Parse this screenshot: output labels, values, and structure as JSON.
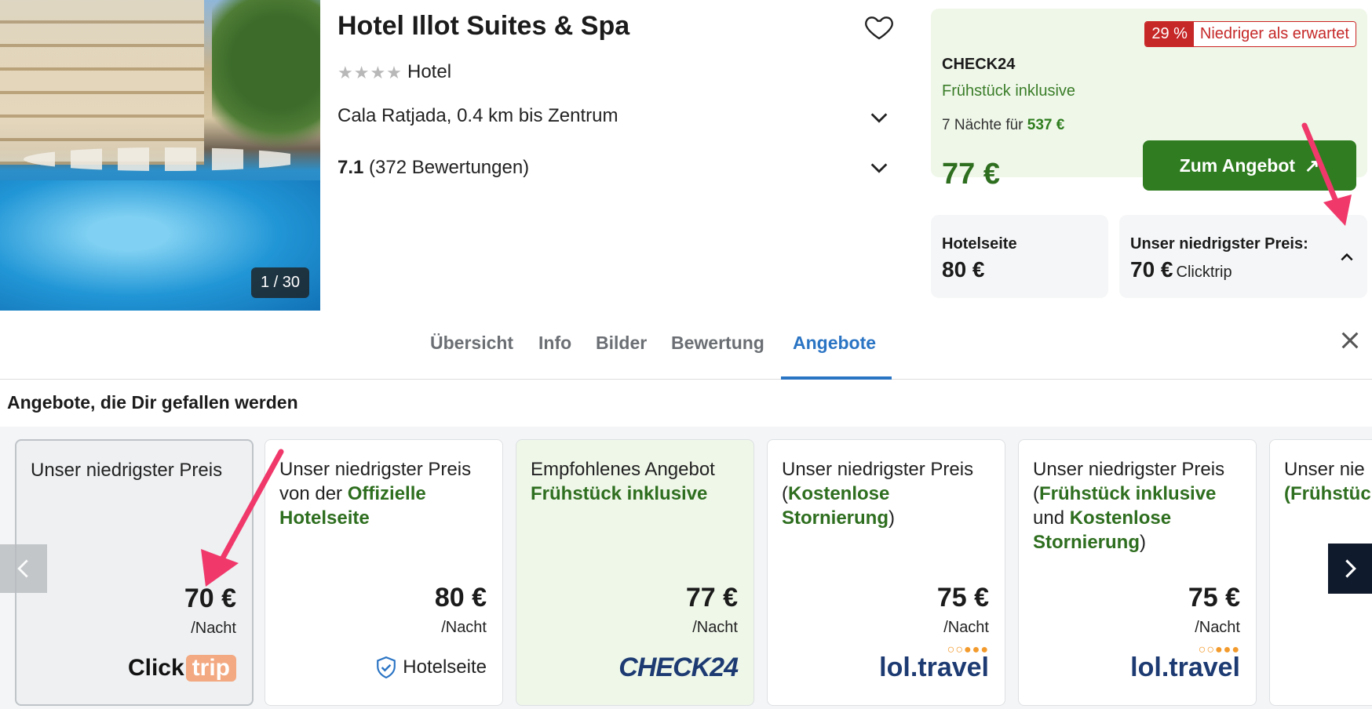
{
  "hotel": {
    "name": "Hotel Illot Suites & Spa",
    "stars": "★★★★",
    "type": "Hotel",
    "location": "Cala Ratjada, 0.4 km bis Zentrum",
    "rating_score": "7.1",
    "rating_count": "(372 Bewertungen)",
    "photo_counter": "1 / 30"
  },
  "price_box": {
    "badge_pct": "29 %",
    "badge_text": "Niedriger als erwartet",
    "provider": "CHECK24",
    "breakfast": "Frühstück inklusive",
    "nights_prefix": "7 Nächte für",
    "nights_total": "537 €",
    "price": "77 €",
    "cta_label": "Zum Angebot",
    "cta_icon": "↗"
  },
  "mini": {
    "hotelsite_label": "Hotelseite",
    "hotelsite_price": "80 €",
    "lowest_label": "Unser niedrigster Preis:",
    "lowest_price": "70 €",
    "lowest_source": "Clicktrip"
  },
  "tabs": [
    {
      "label": "Übersicht"
    },
    {
      "label": "Info"
    },
    {
      "label": "Bilder"
    },
    {
      "label": "Bewertung"
    },
    {
      "label": "Angebote"
    }
  ],
  "offers_title": "Angebote, die Dir gefallen werden",
  "offers": [
    {
      "head": "Unser niedrigster Preis",
      "price": "70 €",
      "unit": "/Nacht",
      "logo_a": "Click",
      "logo_b": "trip"
    },
    {
      "head_a": "Unser niedrigster Preis von der ",
      "head_b": "Offizielle Hotelseite",
      "price": "80 €",
      "unit": "/Nacht",
      "logo": "Hotelseite"
    },
    {
      "head_a": "Empfohlenes Angebot",
      "head_b": "Frühstück inklusive",
      "price": "77 €",
      "unit": "/Nacht",
      "logo": "CHECK24"
    },
    {
      "head_a": "Unser niedrigster Preis (",
      "head_b": "Kostenlose Stornierung",
      "head_c": ")",
      "price": "75 €",
      "unit": "/Nacht",
      "logo": "lol.travel"
    },
    {
      "head_a": "Unser niedrigster Preis (",
      "head_b": "Frühstück inklusive",
      "head_c": " und ",
      "head_d": "Kostenlose Stornierung",
      "head_e": ")",
      "price": "75 €",
      "unit": "/Nacht",
      "logo": "lol.travel"
    },
    {
      "head_a": "Unser nie",
      "head_b": "(Frühstüc"
    }
  ],
  "colors": {
    "brand_green": "#2f7d20",
    "accent_blue": "#2a74c4",
    "badge_red": "#c62828",
    "annotation_pink": "#f0386b"
  },
  "icons": {
    "dots": "○○●●●"
  }
}
